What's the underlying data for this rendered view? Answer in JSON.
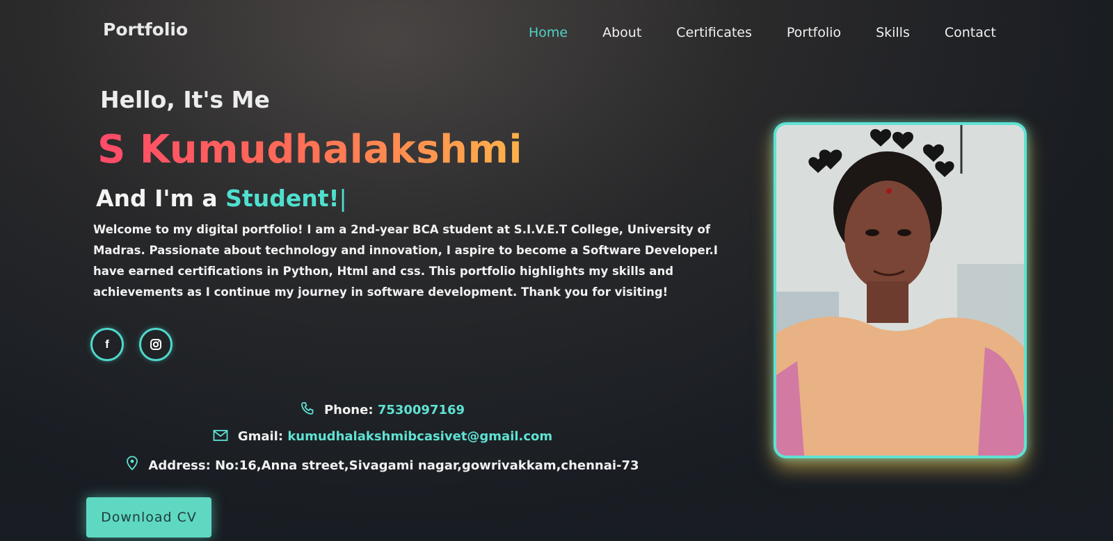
{
  "header": {
    "logo": "Portfolio",
    "nav": [
      "Home",
      "About",
      "Certificates",
      "Portfolio",
      "Skills",
      "Contact"
    ],
    "active_index": 0
  },
  "hero": {
    "greeting": "Hello, It's Me",
    "name": "S Kumudhalakshmi",
    "role_prefix": "And I'm a",
    "role_highlight": "Student!",
    "role_cursor": "|",
    "bio": "Welcome to my digital portfolio! I am a 2nd-year BCA student at S.I.V.E.T College, University of Madras. Passionate about technology and innovation, I aspire to become a Software Developer.I have earned certifications in Python, Html and css. This portfolio highlights my skills and achievements as I continue my journey in software development. Thank you for visiting!"
  },
  "social": [
    {
      "icon": "facebook-icon",
      "glyph": "f"
    },
    {
      "icon": "instagram-icon"
    }
  ],
  "contact": {
    "phone_label": "Phone:",
    "phone_value": "7530097169",
    "gmail_label": "Gmail:",
    "gmail_value": "kumudhalakshmibcasivet@gmail.com",
    "address_label": "Address:",
    "address_value": "No:16,Anna street,Sivagami nagar,gowrivakkam,chennai-73"
  },
  "download_button": "Download CV",
  "colors": {
    "accent": "#4fd3c8",
    "name_gradient_start": "#ff4a6a",
    "name_gradient_end": "#ffb24a",
    "button_bg": "#5fd8c2",
    "photo_border": "#5fe2d3",
    "photo_glow": "#ffcd50"
  }
}
